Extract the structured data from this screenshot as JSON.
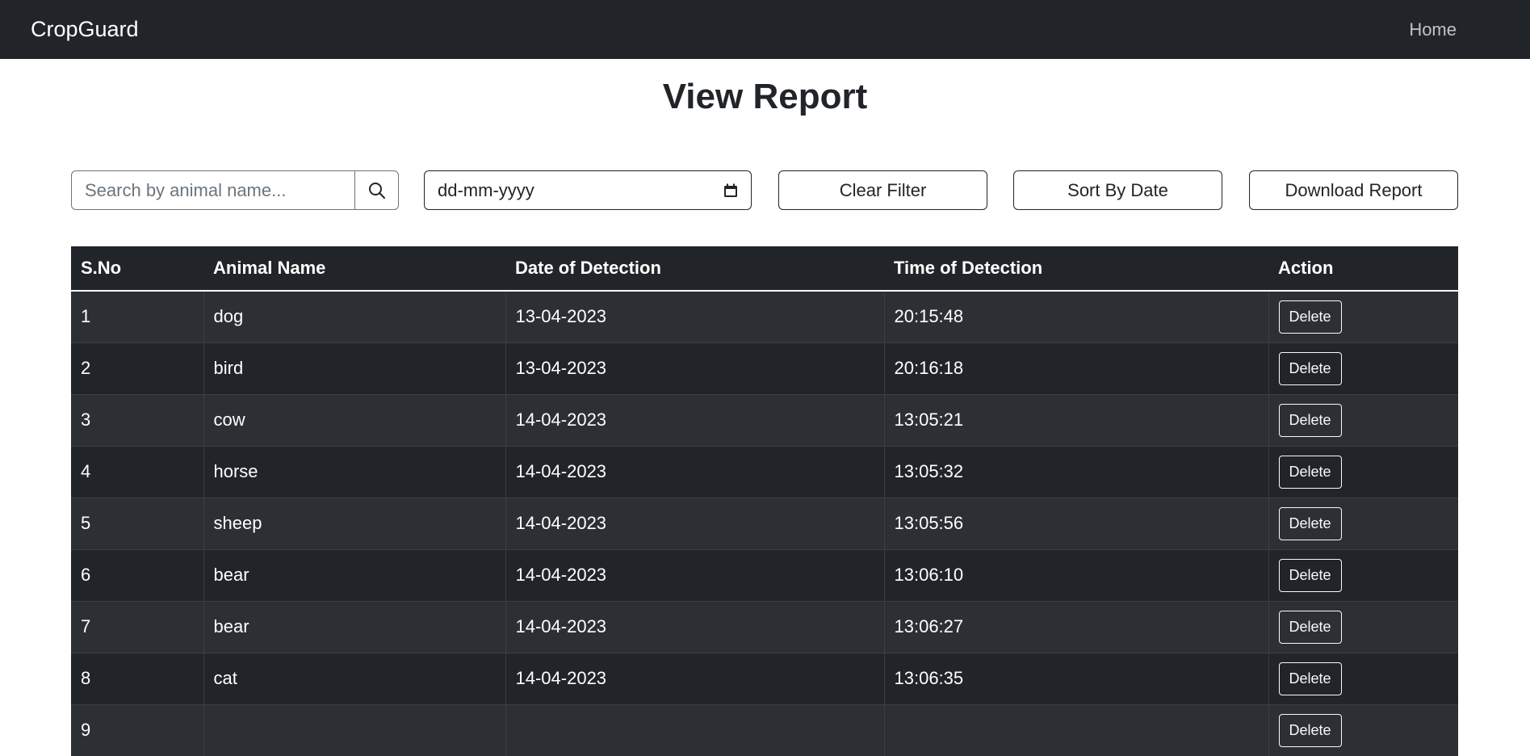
{
  "nav": {
    "brand": "CropGuard",
    "home": "Home"
  },
  "page": {
    "title": "View Report"
  },
  "filters": {
    "search_placeholder": "Search by animal name...",
    "date_placeholder": "dd-mm-yyyy",
    "clear_label": "Clear Filter",
    "sort_label": "Sort By Date",
    "download_label": "Download Report"
  },
  "table": {
    "headers": [
      "S.No",
      "Animal Name",
      "Date of Detection",
      "Time of Detection",
      "Action"
    ],
    "rows": [
      {
        "sno": "1",
        "animal": "dog",
        "date": "13-04-2023",
        "time": "20:15:48",
        "action": "Delete"
      },
      {
        "sno": "2",
        "animal": "bird",
        "date": "13-04-2023",
        "time": "20:16:18",
        "action": "Delete"
      },
      {
        "sno": "3",
        "animal": "cow",
        "date": "14-04-2023",
        "time": "13:05:21",
        "action": "Delete"
      },
      {
        "sno": "4",
        "animal": "horse",
        "date": "14-04-2023",
        "time": "13:05:32",
        "action": "Delete"
      },
      {
        "sno": "5",
        "animal": "sheep",
        "date": "14-04-2023",
        "time": "13:05:56",
        "action": "Delete"
      },
      {
        "sno": "6",
        "animal": "bear",
        "date": "14-04-2023",
        "time": "13:06:10",
        "action": "Delete"
      },
      {
        "sno": "7",
        "animal": "bear",
        "date": "14-04-2023",
        "time": "13:06:27",
        "action": "Delete"
      },
      {
        "sno": "8",
        "animal": "cat",
        "date": "14-04-2023",
        "time": "13:06:35",
        "action": "Delete"
      },
      {
        "sno": "9",
        "animal": "",
        "date": "",
        "time": "",
        "action": "Delete"
      }
    ]
  },
  "colors": {
    "navbar": "#212529",
    "row_odd": "#2c3034",
    "row_even": "#212529"
  }
}
